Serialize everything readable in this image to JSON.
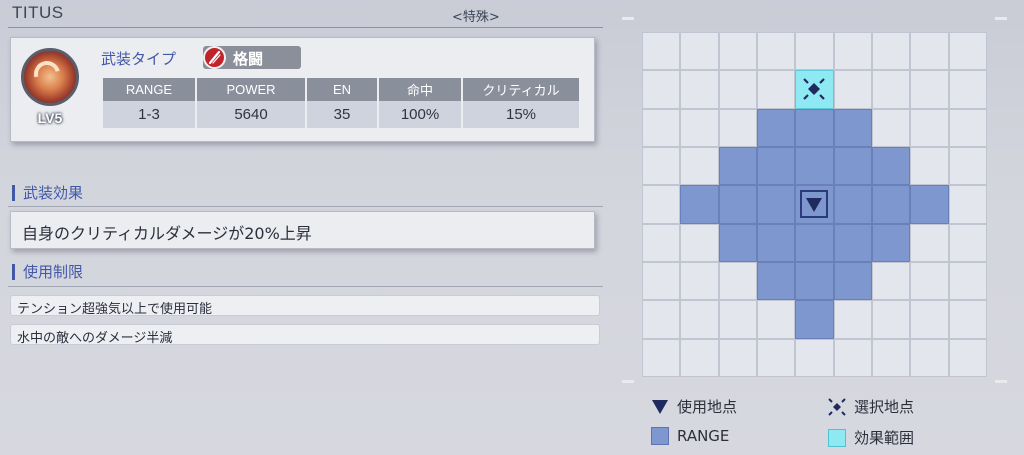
{
  "weapon": {
    "name": "TITUS",
    "category": "<特殊>",
    "level": "LV5"
  },
  "type": {
    "label": "武装タイプ",
    "value": "格闘",
    "icon": "slash-icon"
  },
  "stats": {
    "headers": [
      "RANGE",
      "POWER",
      "EN",
      "命中",
      "クリティカル"
    ],
    "values": [
      "1-3",
      "5640",
      "35",
      "100%",
      "15%"
    ]
  },
  "effect": {
    "title": "武装効果",
    "text": "自身のクリティカルダメージが20%上昇"
  },
  "restrictions": {
    "title": "使用制限",
    "items": [
      "テンション超強気以上で使用可能",
      "水中の敵へのダメージ半減"
    ]
  },
  "range_grid": {
    "columns": 9,
    "rows": 9,
    "range_color": "#7f97cf",
    "effect_color": "#8ee9f3",
    "use_point": [
      4,
      4
    ],
    "select_point": [
      4,
      1
    ],
    "range_cells": [
      [
        3,
        2
      ],
      [
        4,
        2
      ],
      [
        5,
        2
      ],
      [
        2,
        3
      ],
      [
        3,
        3
      ],
      [
        4,
        3
      ],
      [
        5,
        3
      ],
      [
        6,
        3
      ],
      [
        1,
        4
      ],
      [
        2,
        4
      ],
      [
        3,
        4
      ],
      [
        4,
        4
      ],
      [
        5,
        4
      ],
      [
        6,
        4
      ],
      [
        7,
        4
      ],
      [
        2,
        5
      ],
      [
        3,
        5
      ],
      [
        4,
        5
      ],
      [
        5,
        5
      ],
      [
        6,
        5
      ],
      [
        3,
        6
      ],
      [
        4,
        6
      ],
      [
        5,
        6
      ],
      [
        4,
        7
      ]
    ],
    "effect_cells": [
      [
        4,
        1
      ]
    ]
  },
  "legend": {
    "use_point": "使用地点",
    "select_point": "選択地点",
    "range": "RANGE",
    "effect_area": "効果範囲"
  }
}
